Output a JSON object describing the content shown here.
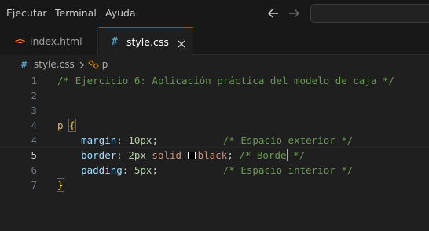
{
  "menu": {
    "items": [
      "Ejecutar",
      "Terminal",
      "Ayuda"
    ]
  },
  "nav": {
    "back_icon": "arrow-left-icon",
    "forward_icon": "arrow-right-icon"
  },
  "tabs": [
    {
      "icon": "<>",
      "label": "index.html",
      "active": false
    },
    {
      "icon": "#",
      "label": "style.css",
      "active": true
    }
  ],
  "breadcrumb": {
    "file_icon": "#",
    "file": "style.css",
    "symbol": "p"
  },
  "editor": {
    "line_numbers": [
      "1",
      "2",
      "3",
      "4",
      "5",
      "6",
      "7"
    ],
    "active_line": "5",
    "lines": {
      "l1_comment": "/* Ejercicio 6: Aplicación práctica del modelo de caja */",
      "l4_selector": "p",
      "l4_brace": "{",
      "l4_prop": "margin",
      "l4_colon": ": ",
      "l4_value": "10px",
      "l4_semi": ";",
      "l4_pad": "           ",
      "l4_comment": "/* Espacio exterior */",
      "l5_prop": "border",
      "l5_colon": ": ",
      "l5_num": "2px",
      "l5_style": " solid ",
      "l5_color": "black",
      "l5_semi": "; ",
      "l5_comment_a": "/* Borde",
      "l5_comment_b": " */",
      "l6_prop": "padding",
      "l6_colon": ": ",
      "l6_value": "5px",
      "l6_semi": ";",
      "l6_pad": "           ",
      "l6_comment": "/* Espacio interior */",
      "l7_brace": "}"
    }
  },
  "colors": {
    "accent": "#0078d4",
    "comment": "#6a9955",
    "selector": "#d7ba7d",
    "property": "#9cdcfe",
    "number": "#b5cea8",
    "value": "#ce9178",
    "brace": "#ffd700"
  }
}
